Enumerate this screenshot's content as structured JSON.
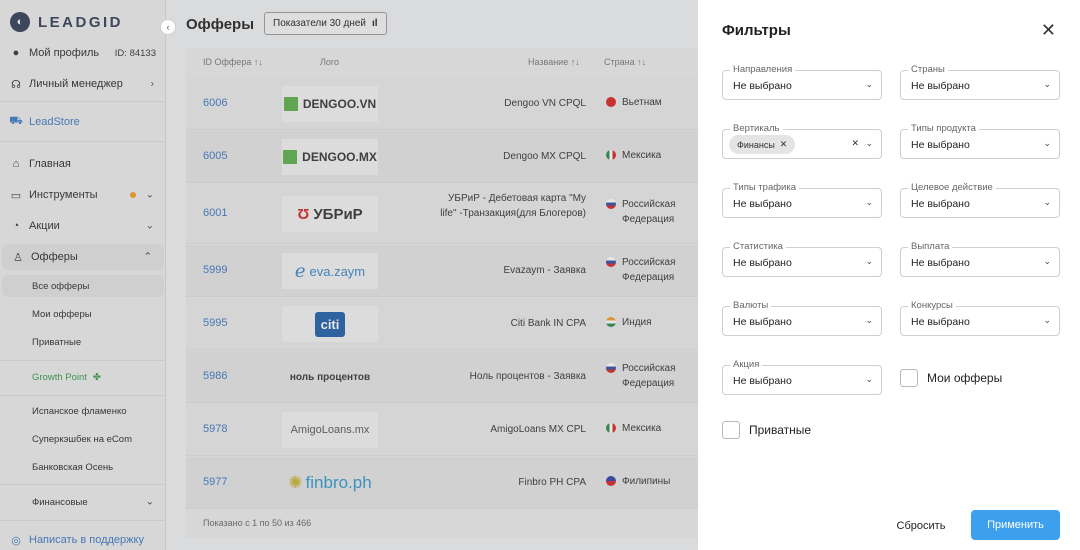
{
  "brand": {
    "name": "LEADGID"
  },
  "sidebar": {
    "profile": {
      "label": "Мой профиль",
      "id_text": "ID: 84133"
    },
    "manager": {
      "label": "Личный менеджер"
    },
    "store": {
      "label": "LeadStore"
    },
    "items": [
      {
        "label": "Главная",
        "icon": "home-icon"
      },
      {
        "label": "Инструменты",
        "icon": "tools-icon"
      },
      {
        "label": "Акции",
        "icon": "promo-icon"
      },
      {
        "label": "Офферы",
        "icon": "offers-icon"
      }
    ],
    "offers_sub": [
      "Все офферы",
      "Мои офферы",
      "Приватные"
    ],
    "growth": {
      "label": "Growth Point"
    },
    "promos": [
      "Испанское фламенко",
      "Суперкэшбек на eCom",
      "Банковская Осень"
    ],
    "finance": {
      "label": "Финансовые"
    },
    "support": {
      "label": "Написать в поддержку"
    }
  },
  "main": {
    "title": "Офферы",
    "period_button": "Показатели 30 дней",
    "columns": {
      "id": "ID Оффера",
      "logo": "Лого",
      "name": "Название",
      "country": "Страна"
    },
    "rows": [
      {
        "id": "6006",
        "logo": "DENGOO.VN",
        "name": "Dengoo VN CPQL",
        "country": "Вьетнам",
        "flag": "#d8231f"
      },
      {
        "id": "6005",
        "logo": "DENGOO.MX",
        "name": "Dengoo MX CPQL",
        "country": "Мексика",
        "flag": "#2a8a4a"
      },
      {
        "id": "6001",
        "logo": "УБРиР",
        "name": "УБРиР - Дебетовая карта \"My life\" -Транзакция(для Блогеров)",
        "country": "Российская Федерация",
        "flag": "#2b4fa8"
      },
      {
        "id": "5999",
        "logo": "eva.zaym",
        "name": "Evazaym - Заявка",
        "country": "Российская Федерация",
        "flag": "#2b4fa8"
      },
      {
        "id": "5995",
        "logo": "citi",
        "name": "Citi Bank IN CPA",
        "country": "Индия",
        "flag": "#f29a2e"
      },
      {
        "id": "5986",
        "logo": "ноль процентов",
        "name": "Ноль процентов - Заявка",
        "country": "Российская Федерация",
        "flag": "#2b4fa8"
      },
      {
        "id": "5978",
        "logo": "AmigoLoans.mx",
        "name": "AmigoLoans MX CPL",
        "country": "Мексика",
        "flag": "#2a8a4a"
      },
      {
        "id": "5977",
        "logo": "finbro.ph",
        "name": "Finbro PH CPA",
        "country": "Филипины",
        "flag": "#2b3fa8"
      }
    ],
    "footer": "Показано с 1 по 50 из 466"
  },
  "filters": {
    "title": "Фильтры",
    "fields": [
      {
        "label": "Направления",
        "value": "Не выбрано"
      },
      {
        "label": "Страны",
        "value": "Не выбрано"
      },
      {
        "label": "Вертикаль",
        "value": "",
        "chip": "Финансы"
      },
      {
        "label": "Типы продукта",
        "value": "Не выбрано"
      },
      {
        "label": "Типы трафика",
        "value": "Не выбрано"
      },
      {
        "label": "Целевое действие",
        "value": "Не выбрано"
      },
      {
        "label": "Статистика",
        "value": "Не выбрано"
      },
      {
        "label": "Выплата",
        "value": "Не выбрано"
      },
      {
        "label": "Валюты",
        "value": "Не выбрано"
      },
      {
        "label": "Конкурсы",
        "value": "Не выбрано"
      },
      {
        "label": "Акция",
        "value": "Не выбрано"
      }
    ],
    "checkbox_my": "Мои офферы",
    "checkbox_private": "Приватные",
    "reset": "Сбросить",
    "apply": "Применить"
  }
}
